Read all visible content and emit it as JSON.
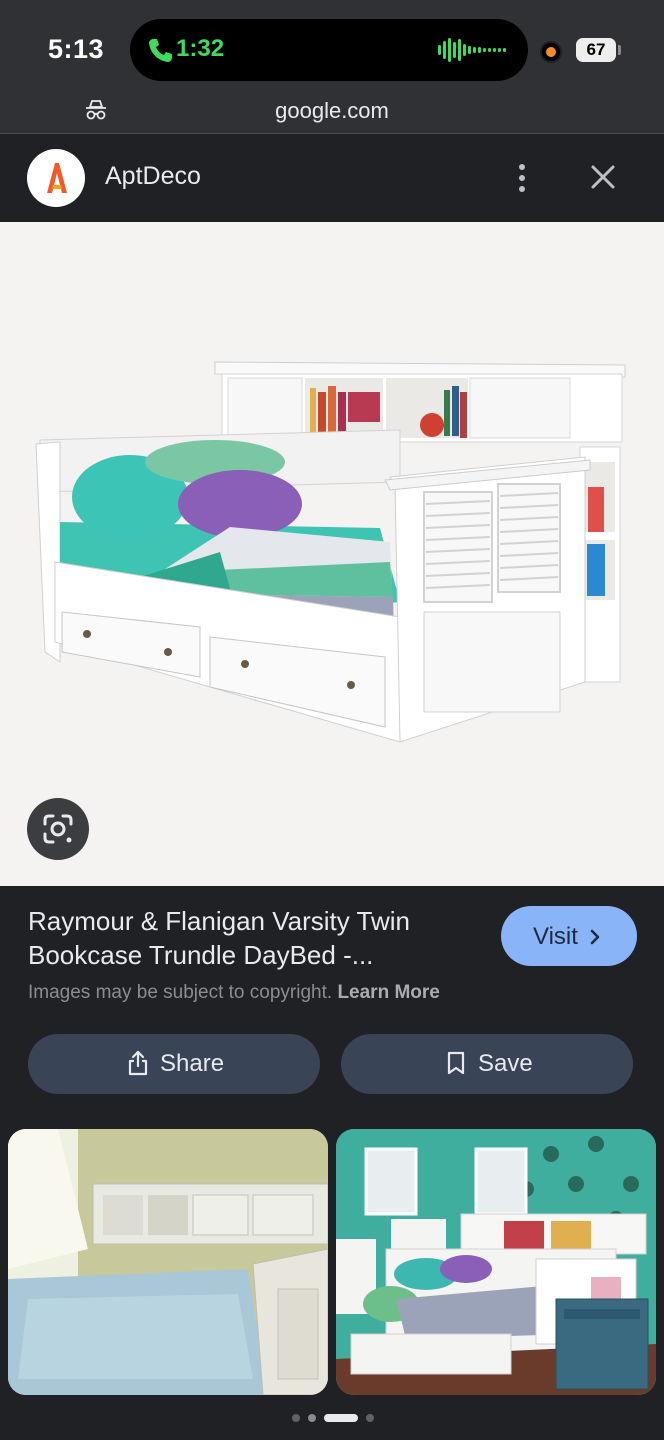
{
  "status_bar": {
    "time": "5:13",
    "call_timer": "1:32",
    "battery": "67",
    "url": "google.com"
  },
  "source": {
    "name": "AptDeco",
    "logo_letter": "A",
    "more_icon": "more-vert-icon",
    "close_icon": "close-icon"
  },
  "result": {
    "title": "Raymour & Flanigan Varsity Twin Bookcase Trundle DayBed -...",
    "visit_label": "Visit",
    "copyright_text": "Images may be subject to copyright.",
    "learn_more": "Learn More",
    "share_label": "Share",
    "save_label": "Save"
  },
  "colors": {
    "background": "#202124",
    "accent": "#8ab4f8",
    "action_button": "#394457",
    "call_green": "#3ddc5a"
  },
  "pager": {
    "count": 4,
    "active_index": 2
  }
}
